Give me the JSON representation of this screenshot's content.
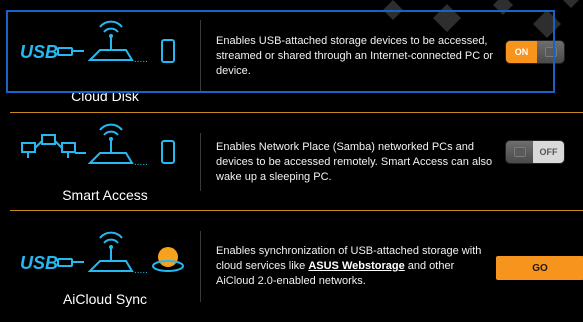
{
  "features": [
    {
      "title": "Cloud Disk",
      "description": "Enables USB-attached storage devices to be accessed, streamed or shared through an Internet-connected PC or device.",
      "control": {
        "type": "toggle",
        "label": "ON",
        "state": "on"
      }
    },
    {
      "title": "Smart Access",
      "description": "Enables Network Place (Samba) networked PCs and devices to be accessed remotely. Smart Access can also wake up a sleeping PC.",
      "control": {
        "type": "toggle",
        "label": "OFF",
        "state": "off"
      }
    },
    {
      "title": "AiCloud Sync",
      "description_before": "Enables synchronization of USB-attached storage with cloud services like ",
      "link_text": "ASUS Webstorage",
      "description_after": " and other AiCloud 2.0-enabled networks.",
      "control": {
        "type": "button",
        "label": "GO"
      }
    }
  ],
  "icons": {
    "usb_label": "USB",
    "colors": {
      "cyan": "#25b9f2",
      "accent": "#f7941d",
      "divider": "#c78a1a",
      "selection": "#1a63c6"
    }
  }
}
